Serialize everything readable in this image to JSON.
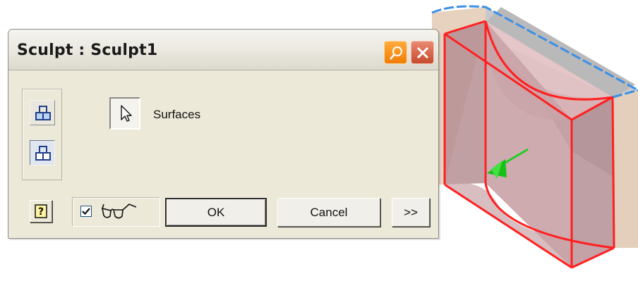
{
  "dialog": {
    "title": "Sculpt : Sculpt1",
    "title_icons": [
      "pin-icon",
      "close-icon"
    ],
    "side_buttons": [
      "add-solid-icon",
      "remove-solid-icon"
    ],
    "selection": {
      "label": "Surfaces",
      "icon": "arrow-cursor-icon"
    },
    "preview": {
      "checked": true,
      "icon": "glasses-icon"
    },
    "buttons": {
      "help_icon": "help-icon",
      "ok": "OK",
      "cancel": "Cancel",
      "more": ">>"
    }
  },
  "colors": {
    "dialog_bg": "#ece9d8",
    "pin": "#f28a12",
    "close": "#d0573a",
    "edge_highlight": "#ff2020",
    "preview_face": "#c9a1a6",
    "arrow": "#22cc22",
    "selection_blue": "#3a8fe8"
  }
}
